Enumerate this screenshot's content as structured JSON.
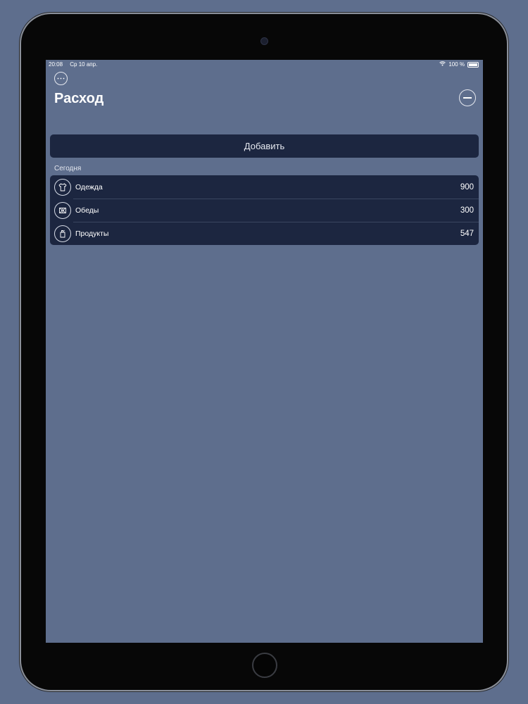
{
  "status_bar": {
    "time": "20:08",
    "date": "Ср 10 апр.",
    "battery": "100 %",
    "wifi_icon": "wifi-icon"
  },
  "nav": {
    "title": "Расход",
    "more_icon": "ellipsis-circle-icon",
    "remove_icon": "minus-circle-icon"
  },
  "add_button_label": "Добавить",
  "section": {
    "header": "Сегодня",
    "items": [
      {
        "icon": "shirt-icon",
        "label": "Одежда",
        "value": "900"
      },
      {
        "icon": "grill-icon",
        "label": "Обеды",
        "value": "300"
      },
      {
        "icon": "grocery-icon",
        "label": "Продукты",
        "value": "547"
      }
    ]
  },
  "colors": {
    "background": "#5e6e8d",
    "card": "#1c2640",
    "text": "#ffffff"
  }
}
